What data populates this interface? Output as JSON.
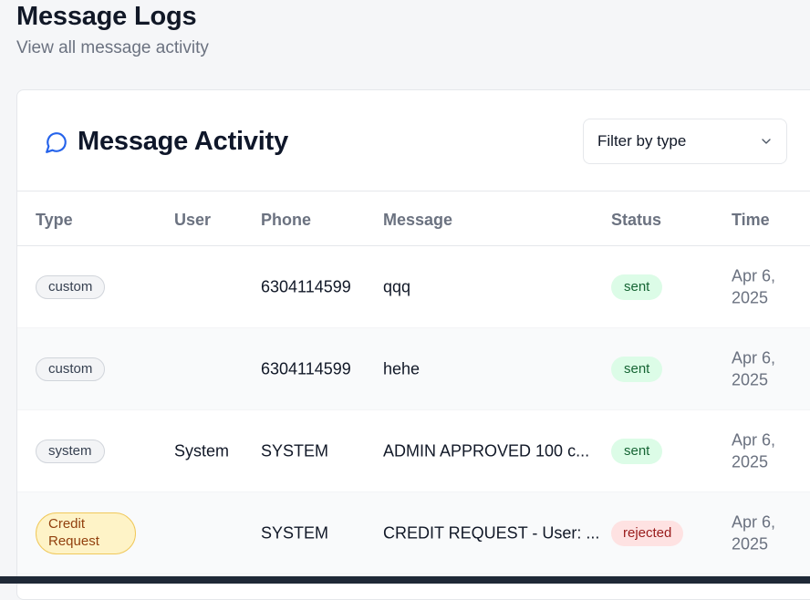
{
  "header": {
    "title": "Message Logs",
    "subtitle": "View all message activity"
  },
  "card": {
    "title": "Message Activity",
    "icon": "message-circle-icon",
    "filter": {
      "label": "Filter by type",
      "icon": "chevron-down-icon"
    }
  },
  "table": {
    "columns": [
      "Type",
      "User",
      "Phone",
      "Message",
      "Status",
      "Time"
    ],
    "rows": [
      {
        "type": "custom",
        "user": "",
        "phone": "6304114599",
        "message": "qqq",
        "status": "sent",
        "time": "Apr 6, 2025"
      },
      {
        "type": "custom",
        "user": "",
        "phone": "6304114599",
        "message": "hehe",
        "status": "sent",
        "time": "Apr 6, 2025"
      },
      {
        "type": "system",
        "user": "System",
        "phone": "SYSTEM",
        "message": "ADMIN APPROVED 100 c...",
        "status": "sent",
        "time": "Apr 6, 2025"
      },
      {
        "type": "Credit Request",
        "user": "",
        "phone": "SYSTEM",
        "message": "CREDIT REQUEST - User: ...",
        "status": "rejected",
        "time": "Apr 6, 2025"
      }
    ]
  },
  "colors": {
    "accent": "#2563eb",
    "sent_bg": "#dcfce7",
    "sent_text": "#166534",
    "rejected_bg": "#fee2e2",
    "rejected_text": "#991b1b",
    "credit_bg": "#fef3c7",
    "credit_border": "#f0c85a"
  }
}
